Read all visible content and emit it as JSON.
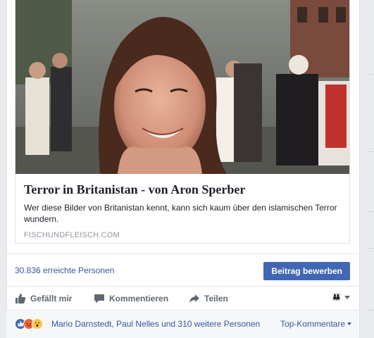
{
  "link_preview": {
    "title": "Terror in Britanistan - von Aron Sperber",
    "description": "Wer diese Bilder von Britanistan kennt, kann sich kaum über den islamischen Terror wundern.",
    "domain": "FISCHUNDFLEISCH.COM"
  },
  "stats": {
    "reach": "30.836 erreichte Personen",
    "boost_label": "Beitrag bewerben"
  },
  "actions": {
    "like_label": "Gefällt mir",
    "comment_label": "Kommentieren",
    "share_label": "Teilen",
    "like_icon": "thumbs-up-icon",
    "comment_icon": "comment-bubble-icon",
    "share_icon": "share-arrow-icon"
  },
  "reactions": {
    "icons": [
      "like-reaction-icon",
      "angry-reaction-icon",
      "wow-reaction-icon"
    ],
    "summary": "Mario Darnstedt, Paul Nelles und 310 weitere Personen",
    "sort_label": "Top-Kommentare"
  },
  "colors": {
    "link_blue": "#365899",
    "button_blue": "#4267b2",
    "secondary_text": "#606770",
    "domain_gray": "#90949c",
    "page_bg": "#e9ebee"
  }
}
